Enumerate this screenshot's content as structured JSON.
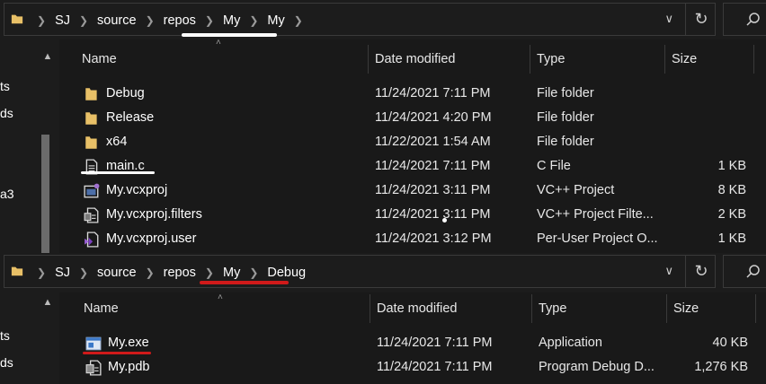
{
  "colors": {
    "background": "#191919",
    "folder": "#e8c067",
    "underline_white": "#ffffff",
    "underline_red": "#d01a1a"
  },
  "window1": {
    "breadcrumb": [
      "SJ",
      "source",
      "repos",
      "My",
      "My"
    ],
    "nav_labels": [
      "ts",
      "ds",
      "a3"
    ],
    "columns": {
      "name": "Name",
      "date": "Date modified",
      "type": "Type",
      "size": "Size"
    },
    "files": [
      {
        "name": "Debug",
        "date": "11/24/2021 7:11 PM",
        "type": "File folder",
        "size": "",
        "icon": "folder-icon"
      },
      {
        "name": "Release",
        "date": "11/24/2021 4:20 PM",
        "type": "File folder",
        "size": "",
        "icon": "folder-icon"
      },
      {
        "name": "x64",
        "date": "11/22/2021 1:54 AM",
        "type": "File folder",
        "size": "",
        "icon": "folder-icon"
      },
      {
        "name": "main.c",
        "date": "11/24/2021 7:11 PM",
        "type": "C File",
        "size": "1 KB",
        "icon": "c-file-icon"
      },
      {
        "name": "My.vcxproj",
        "date": "11/24/2021 3:11 PM",
        "type": "VC++ Project",
        "size": "8 KB",
        "icon": "vcxproj-icon"
      },
      {
        "name": "My.vcxproj.filters",
        "date": "11/24/2021 3:11 PM",
        "type": "VC++ Project Filte...",
        "size": "2 KB",
        "icon": "filters-icon"
      },
      {
        "name": "My.vcxproj.user",
        "date": "11/24/2021 3:12 PM",
        "type": "Per-User Project O...",
        "size": "1 KB",
        "icon": "vs-user-icon"
      }
    ]
  },
  "window2": {
    "breadcrumb": [
      "SJ",
      "source",
      "repos",
      "My",
      "Debug"
    ],
    "nav_labels": [
      "ts",
      "ds"
    ],
    "columns": {
      "name": "Name",
      "date": "Date modified",
      "type": "Type",
      "size": "Size"
    },
    "files": [
      {
        "name": "My.exe",
        "date": "11/24/2021 7:11 PM",
        "type": "Application",
        "size": "40 KB",
        "icon": "exe-icon"
      },
      {
        "name": "My.pdb",
        "date": "11/24/2021 7:11 PM",
        "type": "Program Debug D...",
        "size": "1,276 KB",
        "icon": "pdb-icon"
      }
    ]
  }
}
